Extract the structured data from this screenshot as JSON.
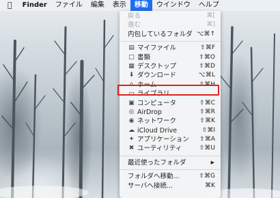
{
  "menubar": {
    "apple_icon": "apple-icon",
    "items": [
      "Finder",
      "ファイル",
      "編集",
      "表示",
      "移動",
      "ウインドウ",
      "ヘルプ"
    ]
  },
  "menu": {
    "back": {
      "label": "戻る",
      "shortcut": "⌘["
    },
    "forward": {
      "label": "進む",
      "shortcut": "⌘]"
    },
    "enclosing": {
      "label": "内包しているフォルダ",
      "shortcut": "⌥⌘↑"
    },
    "places": [
      {
        "label": "マイファイル",
        "shortcut": "⇧⌘F",
        "icon": "all-files-icon"
      },
      {
        "label": "書類",
        "shortcut": "⇧⌘O",
        "icon": "documents-icon"
      },
      {
        "label": "デスクトップ",
        "shortcut": "⇧⌘D",
        "icon": "desktop-icon"
      },
      {
        "label": "ダウンロード",
        "shortcut": "⌥⌘L",
        "icon": "download-icon"
      },
      {
        "label": "ホーム",
        "shortcut": "⇧⌘H",
        "icon": "home-icon"
      },
      {
        "label": "ライブラリ",
        "shortcut": "",
        "icon": "folder-icon"
      },
      {
        "label": "コンピュータ",
        "shortcut": "⇧⌘C",
        "icon": "computer-icon"
      },
      {
        "label": "AirDrop",
        "shortcut": "⇧⌘R",
        "icon": "airdrop-icon"
      },
      {
        "label": "ネットワーク",
        "shortcut": "⇧⌘K",
        "icon": "network-icon"
      },
      {
        "label": "iCloud Drive",
        "shortcut": "⇧⌘I",
        "icon": "icloud-icon"
      },
      {
        "label": "アプリケーション",
        "shortcut": "⇧⌘A",
        "icon": "applications-icon"
      },
      {
        "label": "ユーティリティ",
        "shortcut": "⇧⌘U",
        "icon": "utilities-icon"
      }
    ],
    "recent": {
      "label": "最近使ったフォルダ"
    },
    "goto": {
      "label": "フォルダへ移動...",
      "shortcut": "⇧⌘G"
    },
    "connect": {
      "label": "サーバへ接続...",
      "shortcut": "⌘K"
    }
  },
  "colors": {
    "accent": "#1e6ff0",
    "highlight_box": "#e02020"
  }
}
